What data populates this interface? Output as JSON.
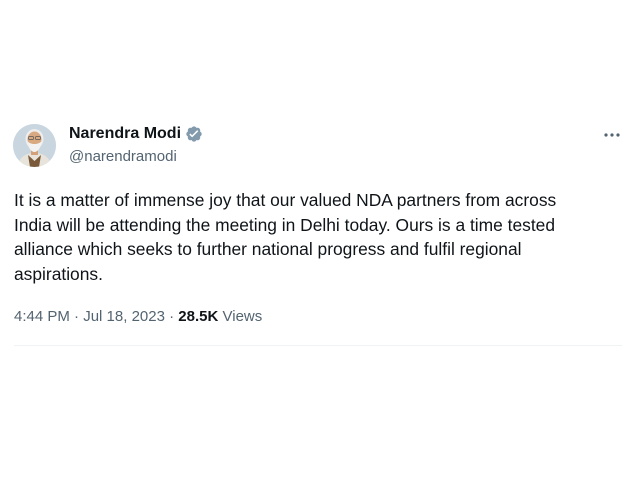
{
  "author": {
    "name": "Narendra Modi",
    "handle": "@narendramodi",
    "verified": true,
    "verified_color": "#829aab"
  },
  "more_icon": "ellipsis-icon",
  "tweet": {
    "text": "It is a matter of immense joy that our valued NDA partners from across\nIndia will be attending the meeting in Delhi today. Ours is a time tested\nalliance which seeks to further national progress and fulfil regional\naspirations."
  },
  "meta": {
    "time": "4:44 PM",
    "separator": "·",
    "date": "Jul 18, 2023",
    "views_count": "28.5K",
    "views_label": "Views"
  },
  "colors": {
    "text_primary": "#0f1419",
    "text_secondary": "#536471",
    "divider": "#eff3f4"
  }
}
